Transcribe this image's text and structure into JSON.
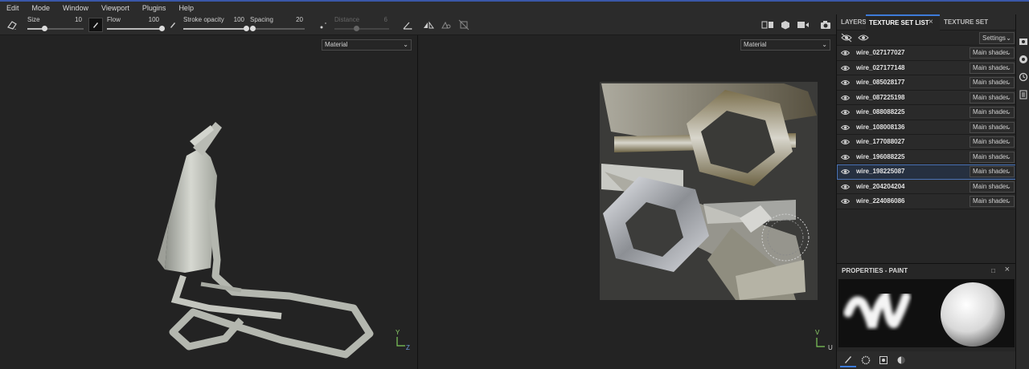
{
  "menu": [
    "Edit",
    "Mode",
    "Window",
    "Viewport",
    "Plugins",
    "Help"
  ],
  "toolbar": {
    "size": {
      "label": "Size",
      "value": "10",
      "fraction": 0.3
    },
    "flow": {
      "label": "Flow",
      "value": "100",
      "fraction": 1.0
    },
    "stroke_opacity": {
      "label": "Stroke opacity",
      "value": "100",
      "fraction": 1.0
    },
    "spacing": {
      "label": "Spacing",
      "value": "20",
      "fraction": 0.05
    },
    "distance": {
      "label": "Distance",
      "value": "6",
      "fraction": 0.4
    }
  },
  "viewport_left": {
    "mode": "Material",
    "axis_y": "Y",
    "axis_z": "Z"
  },
  "viewport_right": {
    "mode": "Material",
    "axis_v": "V",
    "axis_u": "U"
  },
  "panel": {
    "tabs": [
      "LAYERS",
      "TEXTURE SET LIST",
      "TEXTURE SET SETTINGS"
    ],
    "active_tab": "TEXTURE SET LIST",
    "settings_label": "Settings",
    "texture_sets": [
      {
        "name": "wire_027177027",
        "shader": "Main shader"
      },
      {
        "name": "wire_027177148",
        "shader": "Main shader"
      },
      {
        "name": "wire_085028177",
        "shader": "Main shader"
      },
      {
        "name": "wire_087225198",
        "shader": "Main shader"
      },
      {
        "name": "wire_088088225",
        "shader": "Main shader"
      },
      {
        "name": "wire_108008136",
        "shader": "Main shader"
      },
      {
        "name": "wire_177088027",
        "shader": "Main shader"
      },
      {
        "name": "wire_196088225",
        "shader": "Main shader"
      },
      {
        "name": "wire_198225087",
        "shader": "Main shader",
        "selected": true
      },
      {
        "name": "wire_204204204",
        "shader": "Main shader"
      },
      {
        "name": "wire_224086086",
        "shader": "Main shader"
      }
    ],
    "properties_title": "PROPERTIES - PAINT"
  },
  "colors": {
    "accent": "#3d7bd9",
    "panel_bg": "#262626",
    "viewport_bg": "#232323",
    "model": "#c9cbc4"
  }
}
